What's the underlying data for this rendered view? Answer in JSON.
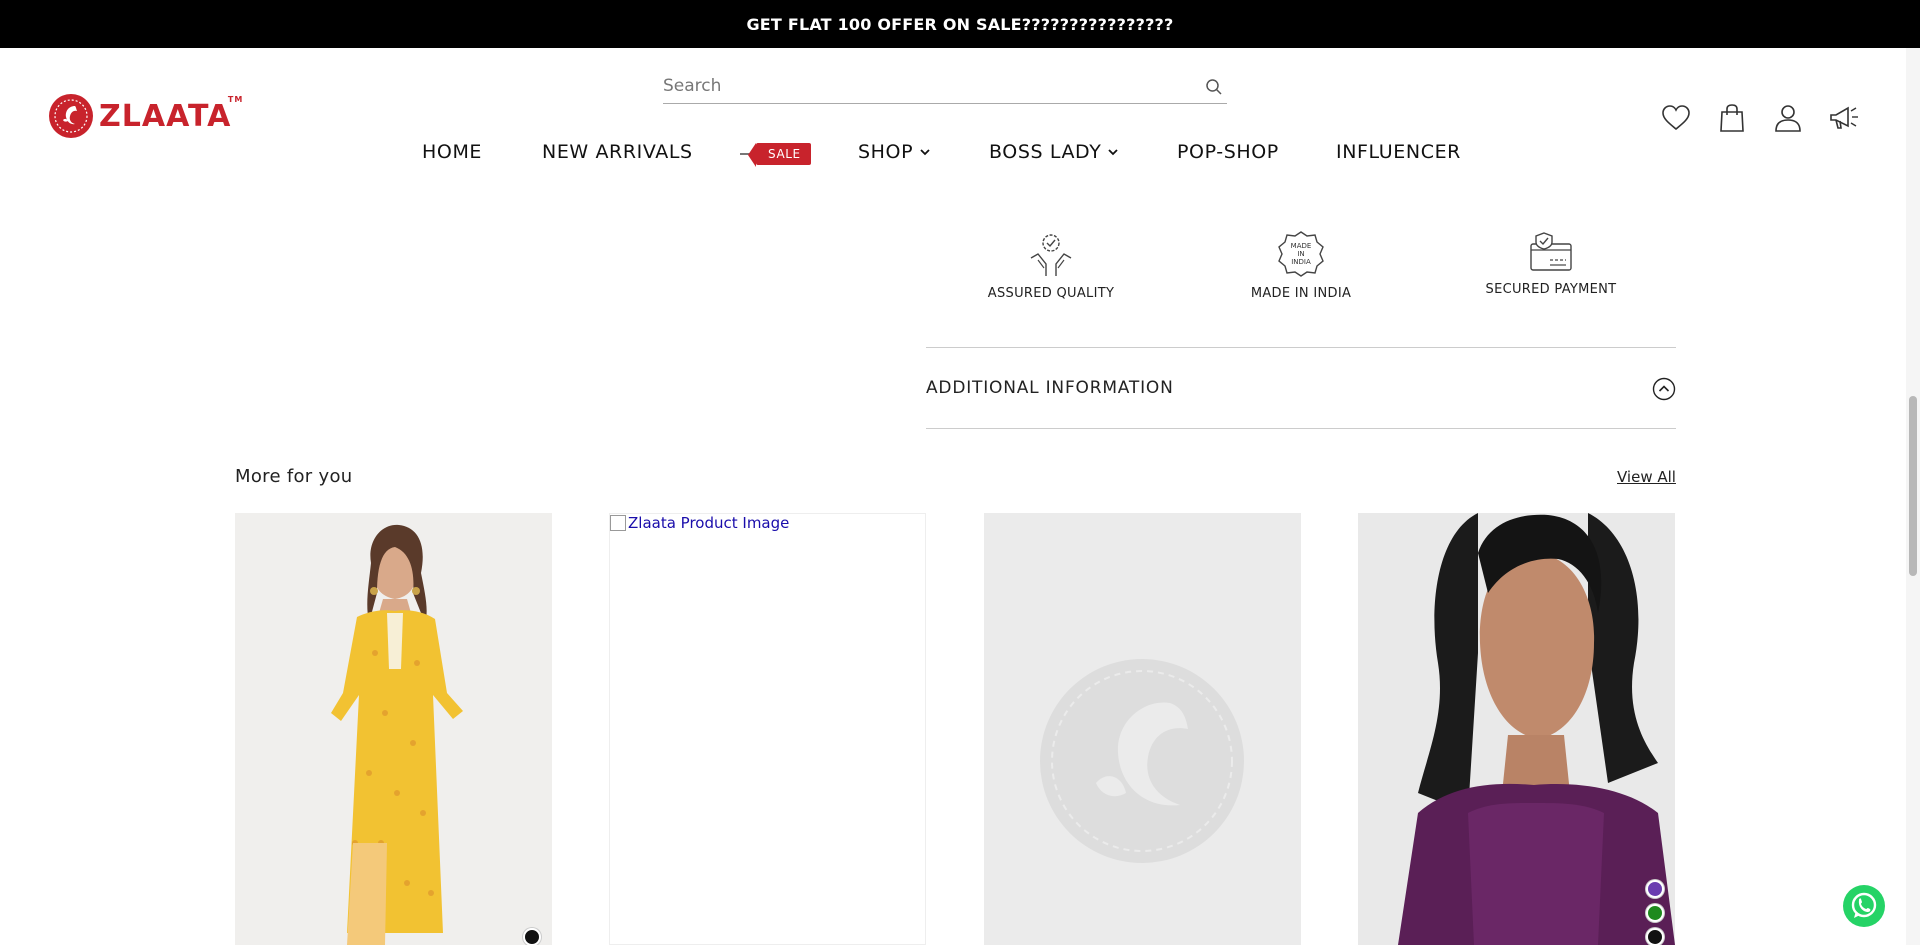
{
  "announcement": "GET FLAT 100 OFFER ON SALE????????????????",
  "brand": {
    "name": "ZLAATA",
    "tm": "TM",
    "color": "#c8232c"
  },
  "search": {
    "placeholder": "Search",
    "icon": "search-icon"
  },
  "nav": {
    "home": "HOME",
    "new_arrivals": "NEW ARRIVALS",
    "sale": "SALE",
    "shop": "SHOP",
    "boss_lady": "BOSS LADY",
    "pop_shop": "POP-SHOP",
    "influencer": "INFLUENCER"
  },
  "header_icons": [
    "heart-icon",
    "bag-icon",
    "user-icon",
    "megaphone-icon"
  ],
  "features": [
    {
      "label": "ASSURED QUALITY",
      "icon": "quality-icon"
    },
    {
      "label": "MADE IN INDIA",
      "icon": "made-in-india-icon",
      "badge": [
        "MADE",
        "IN",
        "INDIA"
      ]
    },
    {
      "label": "SECURED PAYMENT",
      "icon": "secure-payment-icon"
    }
  ],
  "accordion": {
    "title": "ADDITIONAL INFORMATION",
    "state": "collapsed"
  },
  "more_for_you": {
    "title": "More for you",
    "view_all": "View All"
  },
  "products": [
    {
      "image": "yellow-kurta-model",
      "swatches": [
        "#111111"
      ]
    },
    {
      "image_alt": "Zlaata Product Image"
    },
    {
      "image": "placeholder-logo"
    },
    {
      "image": "purple-top-model",
      "swatches": [
        "#6a3db0",
        "#1e8a1e",
        "#111111"
      ]
    }
  ],
  "colors": {
    "accent": "#c8232c",
    "announcement_bg": "#000000",
    "whatsapp": "#25d366"
  }
}
